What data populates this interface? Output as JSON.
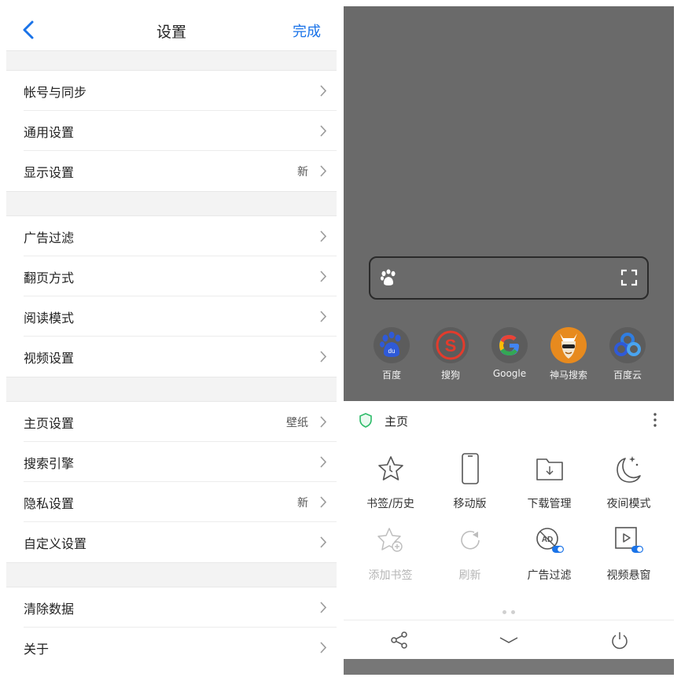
{
  "settings": {
    "title": "设置",
    "done": "完成",
    "items": [
      {
        "label": "帐号与同步",
        "value": ""
      },
      {
        "label": "通用设置",
        "value": ""
      },
      {
        "label": "显示设置",
        "value": "新"
      },
      {
        "label": "广告过滤",
        "value": ""
      },
      {
        "label": "翻页方式",
        "value": ""
      },
      {
        "label": "阅读模式",
        "value": ""
      },
      {
        "label": "视频设置",
        "value": ""
      },
      {
        "label": "主页设置",
        "value": "壁纸"
      },
      {
        "label": "搜索引擎",
        "value": ""
      },
      {
        "label": "隐私设置",
        "value": "新"
      },
      {
        "label": "自定义设置",
        "value": ""
      },
      {
        "label": "清除数据",
        "value": ""
      },
      {
        "label": "关于",
        "value": ""
      }
    ]
  },
  "browser": {
    "quick_links": [
      {
        "label": "百度",
        "icon": "baidu-icon"
      },
      {
        "label": "搜狗",
        "icon": "sogou-icon"
      },
      {
        "label": "Google",
        "icon": "google-icon"
      },
      {
        "label": "神马搜索",
        "icon": "shenma-icon"
      },
      {
        "label": "百度云",
        "icon": "baidu-cloud-icon"
      }
    ],
    "menu": {
      "header": "主页",
      "items": [
        {
          "label": "书签/历史",
          "icon": "bookmark-history-icon",
          "enabled": true
        },
        {
          "label": "移动版",
          "icon": "mobile-icon",
          "enabled": true
        },
        {
          "label": "下载管理",
          "icon": "download-folder-icon",
          "enabled": true
        },
        {
          "label": "夜间模式",
          "icon": "moon-icon",
          "enabled": true
        },
        {
          "label": "添加书签",
          "icon": "add-bookmark-icon",
          "enabled": false
        },
        {
          "label": "刷新",
          "icon": "refresh-icon",
          "enabled": false
        },
        {
          "label": "广告过滤",
          "icon": "ad-filter-icon",
          "enabled": true
        },
        {
          "label": "视频悬窗",
          "icon": "video-float-icon",
          "enabled": true
        }
      ]
    },
    "colors": {
      "accent": "#1a73e8",
      "shield": "#2ebc6a",
      "overlay": "#6a6a6a"
    }
  }
}
